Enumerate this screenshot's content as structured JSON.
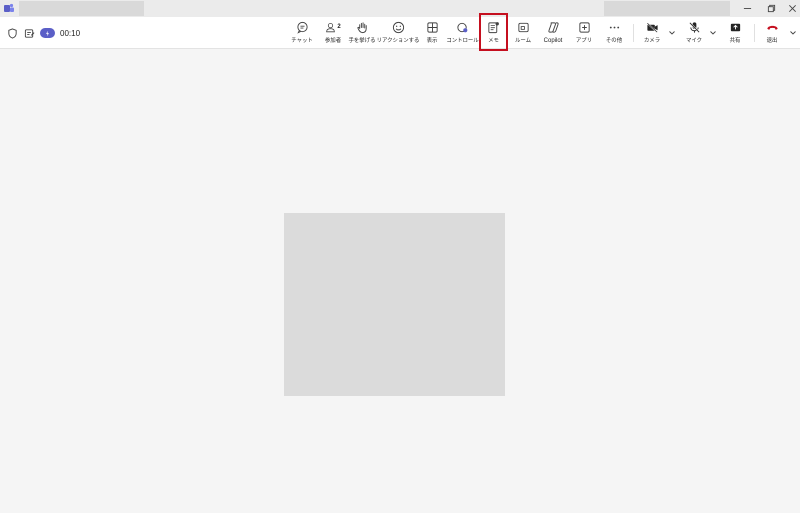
{
  "window": {
    "minimize_icon": "minimize-icon",
    "restore_icon": "restore-icon",
    "close_icon": "close-icon"
  },
  "meeting": {
    "timer": "00:10",
    "participant_count": "2"
  },
  "toolbar": {
    "chat": "チャット",
    "people": "参加者",
    "raise_hand": "手を挙げる",
    "react": "リアクションする",
    "view": "表示",
    "controls": "コントロール",
    "notes": "メモ",
    "rooms": "ルーム",
    "copilot": "Copilot",
    "apps": "アプリ",
    "more": "その他",
    "camera": "カメラ",
    "mic": "マイク",
    "share": "共有",
    "leave": "退出"
  },
  "colors": {
    "accent": "#5b5fc7",
    "highlight": "#c50f1f",
    "leave": "#c50f1f"
  }
}
